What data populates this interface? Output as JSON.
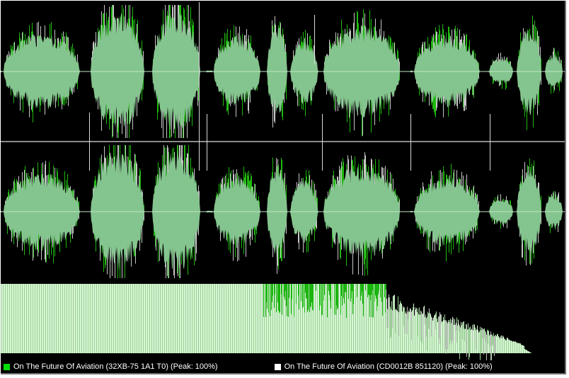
{
  "colors": {
    "background": "#000000",
    "wave_fill": "#84c48e",
    "wave_peak_a": "#1fb80f",
    "wave_peak_b": "#c7c7c7",
    "center_line": "#bfe6c4",
    "channel_divider": "#8a8a8a",
    "segment_marker": "#d9d9d9",
    "spectrum_fill": "#d6f6d4",
    "spectrum_stripe": "#9ccf97",
    "spectrum_peak_a": "#1bb50f",
    "spectrum_peak_b": "#bdbdbd",
    "legend_a": "#00dd00",
    "legend_b": "#ffffff"
  },
  "legend": [
    {
      "label": "On The Future Of Aviation (32XB-75 1A1 T0) (Peak: 100%)",
      "color": "#00dd00"
    },
    {
      "label": "On The Future Of Aviation (CD0012B 851120) (Peak: 100%)",
      "color": "#ffffff"
    }
  ]
}
